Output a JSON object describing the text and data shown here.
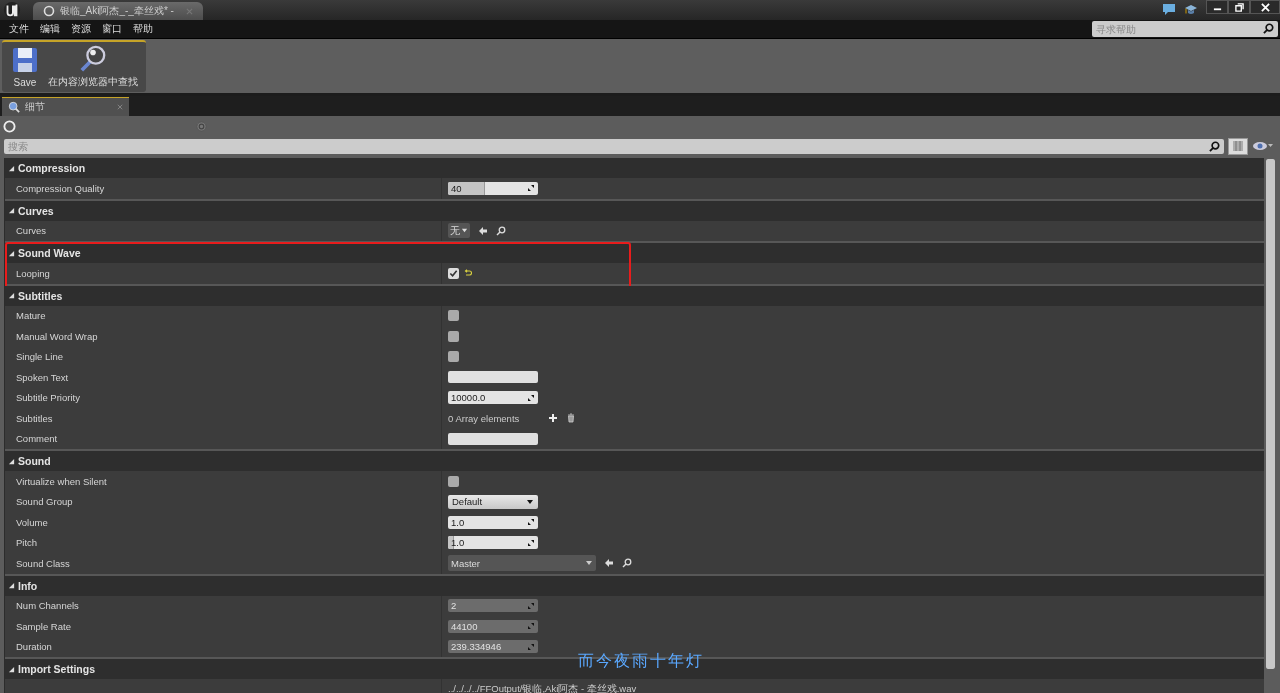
{
  "window": {
    "tab_title": "银临_Aki阿杰_-_牵丝戏* -",
    "help_search": {
      "placeholder": "寻求帮助"
    }
  },
  "menu": [
    "文件",
    "编辑",
    "资源",
    "窗口",
    "帮助"
  ],
  "toolbar": [
    {
      "label": "Save",
      "kind": "save"
    },
    {
      "label": "在内容浏览器中查找",
      "kind": "find"
    }
  ],
  "panel_tab": {
    "label": "细节",
    "selected": true
  },
  "details_search": {
    "placeholder": "搜索"
  },
  "sections": [
    {
      "title": "Compression",
      "expanded": true,
      "rows": [
        {
          "label": "Compression Quality",
          "kind": "spin",
          "value": "40",
          "level": 0.4,
          "read_only": false
        }
      ]
    },
    {
      "title": "Curves",
      "expanded": true,
      "rows": [
        {
          "label": "Curves",
          "kind": "combo",
          "value": "无"
        }
      ]
    },
    {
      "title": "Sound Wave",
      "expanded": true,
      "highlighted": true,
      "rows": [
        {
          "label": "Looping",
          "kind": "check",
          "checked": true,
          "modified": true
        }
      ]
    },
    {
      "title": "Subtitles",
      "expanded": true,
      "rows": [
        {
          "label": "Mature",
          "kind": "check",
          "checked": false
        },
        {
          "label": "Manual Word Wrap",
          "kind": "check",
          "checked": false
        },
        {
          "label": "Single Line",
          "kind": "check",
          "checked": false
        },
        {
          "label": "Spoken Text",
          "kind": "text"
        },
        {
          "label": "Subtitle Priority",
          "kind": "spin",
          "value": "10000.0",
          "read_only": false
        },
        {
          "label": "Subtitles",
          "kind": "array",
          "value": "0 Array elements"
        },
        {
          "label": "Comment",
          "kind": "text"
        }
      ]
    },
    {
      "title": "Sound",
      "expanded": true,
      "rows": [
        {
          "label": "Virtualize when Silent",
          "kind": "check",
          "checked": false
        },
        {
          "label": "Sound Group",
          "kind": "dropdown",
          "value": "Default"
        },
        {
          "label": "Volume",
          "kind": "spin",
          "value": "1.0",
          "read_only": false
        },
        {
          "label": "Pitch",
          "kind": "spin",
          "value": "1.0",
          "level": 0.05,
          "read_only": false
        },
        {
          "label": "Sound Class",
          "kind": "asset",
          "value": "Master"
        }
      ]
    },
    {
      "title": "Info",
      "expanded": true,
      "rows": [
        {
          "label": "Num Channels",
          "kind": "spin",
          "value": "2",
          "read_only": true
        },
        {
          "label": "Sample Rate",
          "kind": "spin",
          "value": "44100",
          "read_only": true
        },
        {
          "label": "Duration",
          "kind": "spin",
          "value": "239.334946",
          "read_only": true
        }
      ]
    },
    {
      "title": "Import Settings",
      "expanded": true,
      "rows": [
        {
          "kind": "path",
          "value": "../../../../FFOutput/银临,Aki阿杰 - 牵丝戏.wav"
        }
      ]
    }
  ],
  "caption": "而今夜雨十年灯"
}
